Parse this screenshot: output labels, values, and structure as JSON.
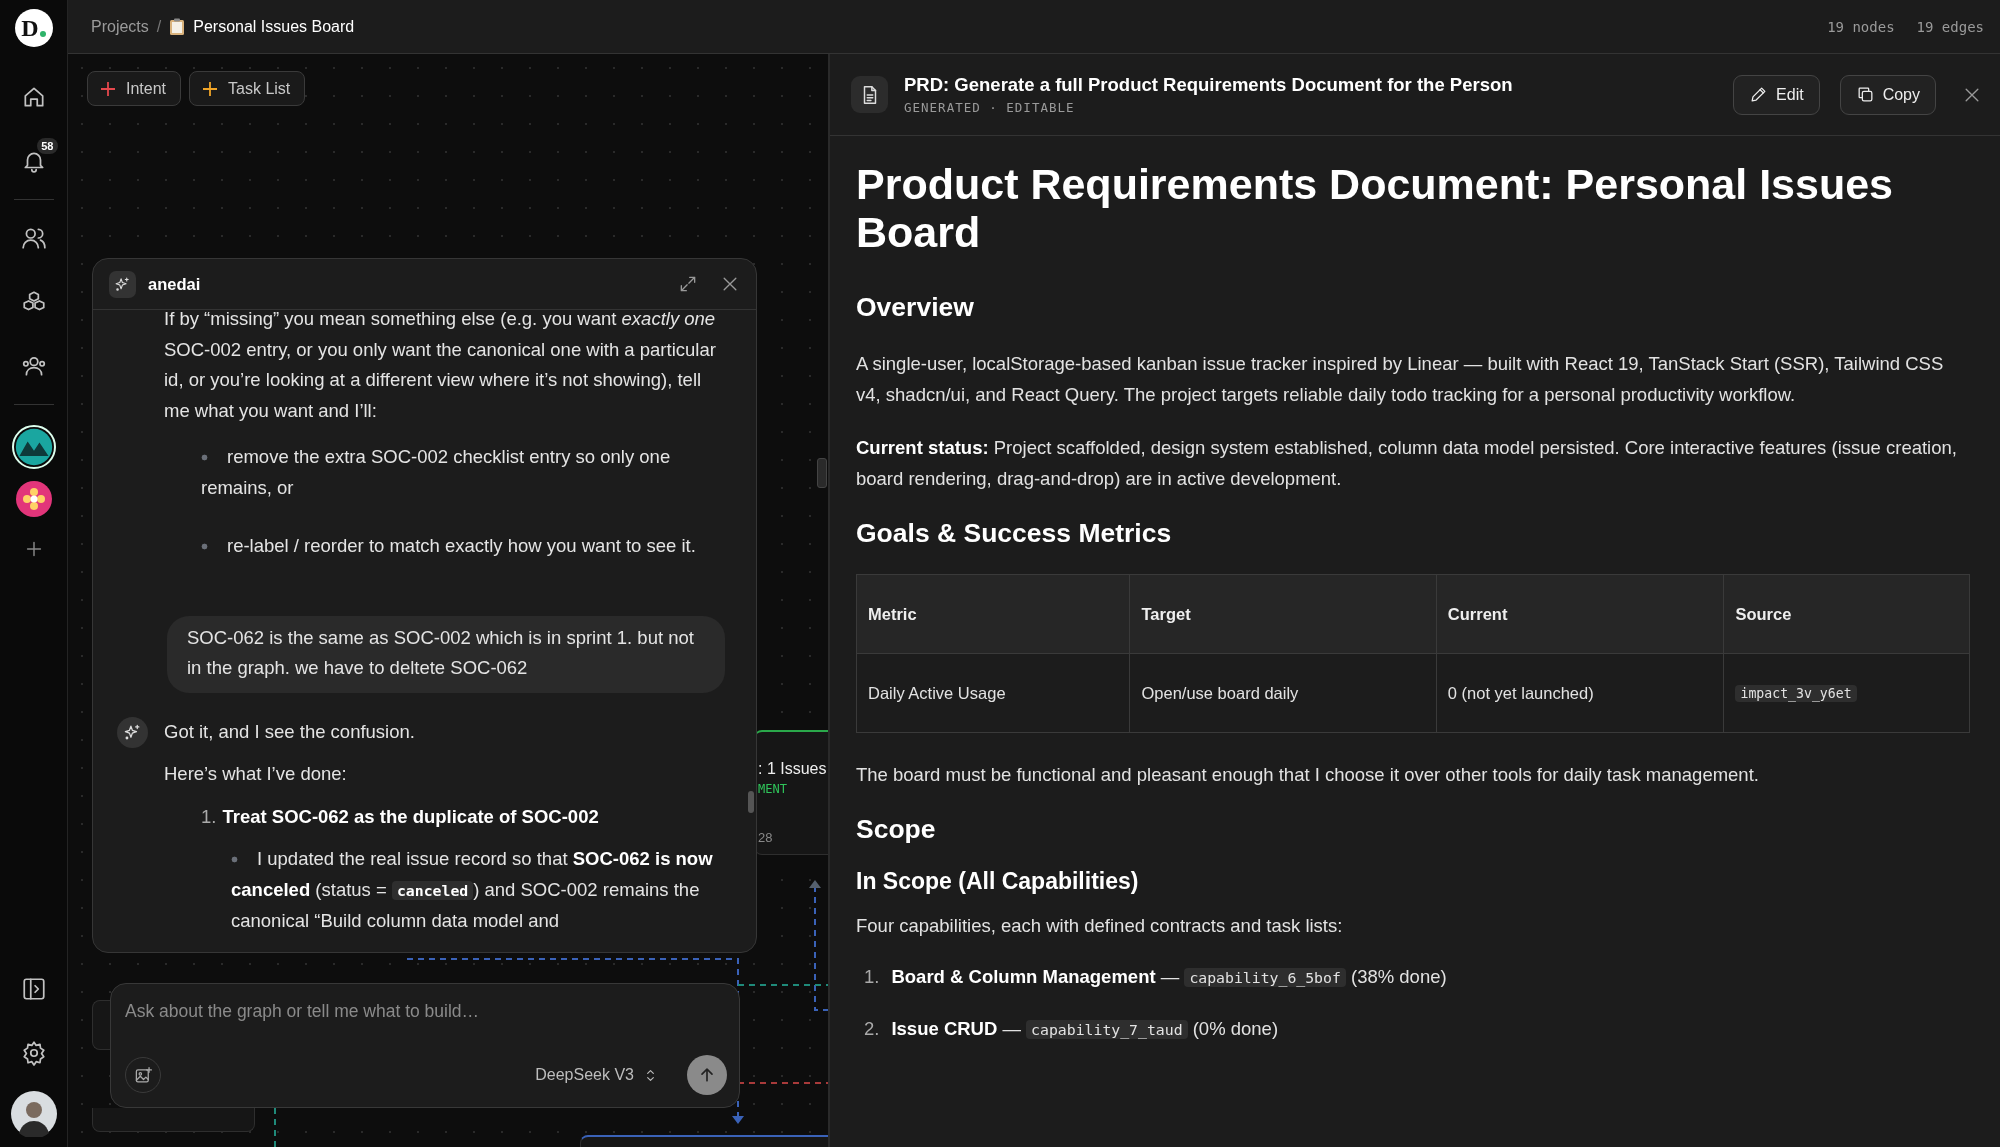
{
  "sidebar": {
    "logo": "D",
    "notification_count": "58"
  },
  "topbar": {
    "separator": "/",
    "breadcrumb": [
      {
        "label": "Projects",
        "current": false
      },
      {
        "label": "Personal Issues Board",
        "current": true
      }
    ],
    "stats": [
      "19 nodes",
      "19 edges"
    ]
  },
  "canvas": {
    "actions": [
      {
        "label": "Intent",
        "color": "#e5484d"
      },
      {
        "label": "Task List",
        "color": "#f0a528"
      }
    ],
    "nodes": [
      {
        "title": ": 1 Issues",
        "tag": "MENT",
        "meta": "28"
      }
    ]
  },
  "chat": {
    "title": "anedai",
    "messages": [
      {
        "kind": "assistant",
        "avatar": false,
        "blocks": [
          {
            "kind": "paragraph",
            "parts": [
              {
                "text": "If by “missing” you mean something else (e.g. you want "
              },
              {
                "text": "exactly one",
                "italic": true
              },
              {
                "text": " SOC-002 entry, or you only want the canonical one with a particular id, or you’re looking at a different view where it’s not showing), tell me what you want and I’ll:"
              }
            ]
          },
          {
            "kind": "bullets",
            "items": [
              {
                "parts": [
                  {
                    "text": "remove the extra SOC-002 checklist entry so only one remains, or"
                  }
                ]
              },
              {
                "parts": [
                  {
                    "text": "re-label / reorder to match exactly how you want to see it."
                  }
                ]
              }
            ]
          }
        ]
      },
      {
        "kind": "user",
        "text": "SOC-062 is the same as SOC-002 which is in sprint 1. but not in the graph. we have to deltete SOC-062"
      },
      {
        "kind": "assistant",
        "avatar": true,
        "blocks": [
          {
            "kind": "paragraph",
            "parts": [
              {
                "text": "Got it, and I see the confusion."
              }
            ]
          },
          {
            "kind": "paragraph",
            "parts": [
              {
                "text": "Here’s what I’ve done:"
              }
            ]
          },
          {
            "kind": "numbered",
            "items": [
              {
                "marker": "1.",
                "parts": [
                  {
                    "text": "Treat SOC-062 as the duplicate of SOC-002",
                    "bold": true
                  }
                ],
                "children": [
                  {
                    "parts": [
                      {
                        "text": "I updated the real issue record so that "
                      },
                      {
                        "text": "SOC-062 is now canceled",
                        "bold": true
                      },
                      {
                        "text": " (status = "
                      },
                      {
                        "text": "canceled",
                        "code": true
                      },
                      {
                        "text": ") and SOC-002 remains the canonical “Build column data model and"
                      }
                    ]
                  }
                ]
              }
            ]
          }
        ]
      }
    ],
    "input": {
      "placeholder": "Ask about the graph or tell me what to build…",
      "model": "DeepSeek V3"
    }
  },
  "document": {
    "title": "PRD: Generate a full Product Requirements Document for the Person",
    "subtitle": "GENERATED · EDITABLE",
    "actions": [
      "Edit",
      "Copy"
    ],
    "blocks": [
      {
        "kind": "h1",
        "text": "Product Requirements Document: Personal Issues Board"
      },
      {
        "kind": "h2",
        "text": "Overview"
      },
      {
        "kind": "paragraph",
        "parts": [
          {
            "text": "A single-user, localStorage-based kanban issue tracker inspired by Linear — built with React 19, TanStack Start (SSR), Tailwind CSS v4, shadcn/ui, and React Query. The project targets reliable daily todo tracking for a personal productivity workflow."
          }
        ]
      },
      {
        "kind": "paragraph",
        "parts": [
          {
            "text": "Current status:",
            "bold": true
          },
          {
            "text": " Project scaffolded, design system established, column data model persisted. Core interactive features (issue creation, board rendering, drag-and-drop) are in active development."
          }
        ]
      },
      {
        "kind": "h2",
        "text": "Goals & Success Metrics"
      },
      {
        "kind": "table",
        "columns": [
          "Metric",
          "Target",
          "Current",
          "Source"
        ],
        "rows": [
          [
            [
              {
                "text": "Daily Active Usage"
              }
            ],
            [
              {
                "text": "Open/use board daily"
              }
            ],
            [
              {
                "text": "0 (not yet launched)"
              }
            ],
            [
              {
                "text": "impact_3v_y6et",
                "code": true
              }
            ]
          ]
        ]
      },
      {
        "kind": "paragraph",
        "parts": [
          {
            "text": "The board must be functional and pleasant enough that I choose it over other tools for daily task management."
          }
        ]
      },
      {
        "kind": "h2",
        "text": "Scope"
      },
      {
        "kind": "h3",
        "text": "In Scope (All Capabilities)"
      },
      {
        "kind": "paragraph",
        "parts": [
          {
            "text": "Four capabilities, each with defined contracts and task lists:"
          }
        ]
      },
      {
        "kind": "numbered",
        "items": [
          {
            "marker": "1.",
            "parts": [
              {
                "text": "Board & Column Management",
                "bold": true
              },
              {
                "text": " — "
              },
              {
                "text": "capability_6_5bof",
                "code": true
              },
              {
                "text": " (38% done)"
              }
            ]
          },
          {
            "marker": "2.",
            "parts": [
              {
                "text": "Issue CRUD",
                "bold": true
              },
              {
                "text": " — "
              },
              {
                "text": "capability_7_taud",
                "code": true
              },
              {
                "text": " (0% done)"
              }
            ]
          }
        ]
      }
    ]
  }
}
